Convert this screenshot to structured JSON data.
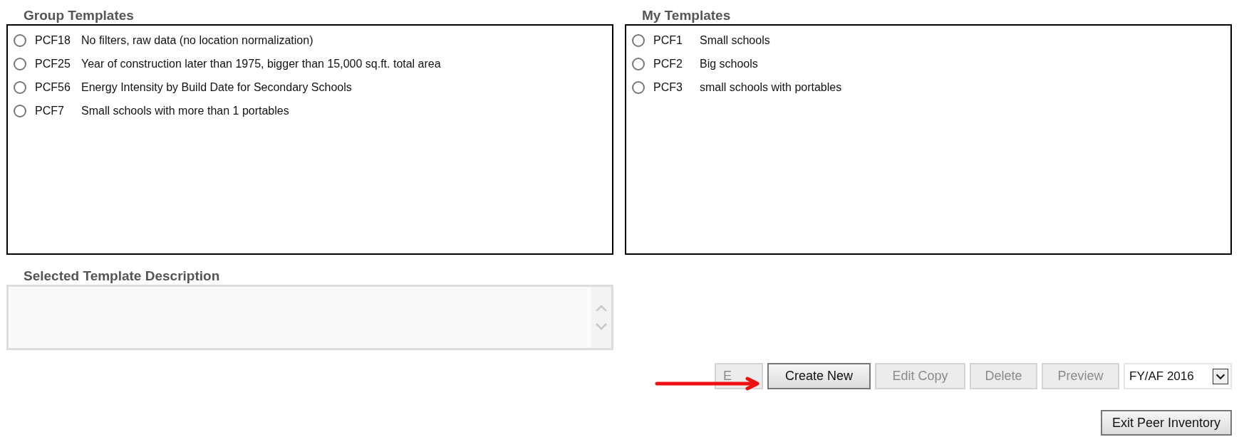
{
  "group_templates": {
    "title": "Group Templates",
    "items": [
      {
        "code": "PCF18",
        "label": "No filters, raw data (no location normalization)",
        "selected": false
      },
      {
        "code": "PCF25",
        "label": "Year of construction later than 1975, bigger than 15,000 sq.ft. total area",
        "selected": false
      },
      {
        "code": "PCF56",
        "label": "Energy Intensity by Build Date for Secondary Schools",
        "selected": false
      },
      {
        "code": "PCF7",
        "label": "Small schools with more than 1 portables",
        "selected": false
      }
    ]
  },
  "my_templates": {
    "title": "My Templates",
    "items": [
      {
        "code": "PCF1",
        "label": "Small schools",
        "selected": false
      },
      {
        "code": "PCF2",
        "label": "Big schools",
        "selected": false
      },
      {
        "code": "PCF3",
        "label": "small schools with portables",
        "selected": false
      }
    ]
  },
  "description": {
    "title": "Selected Template Description"
  },
  "buttons": [
    {
      "label": "E",
      "disabled": true
    },
    {
      "label": "Create New",
      "disabled": false
    },
    {
      "label": "Edit Copy",
      "disabled": true
    },
    {
      "label": "Delete",
      "disabled": true
    },
    {
      "label": "Preview",
      "disabled": true
    }
  ],
  "year_select": {
    "value": "FY/AF 2016"
  },
  "exit_button": {
    "label": "Exit Peer Inventory"
  }
}
